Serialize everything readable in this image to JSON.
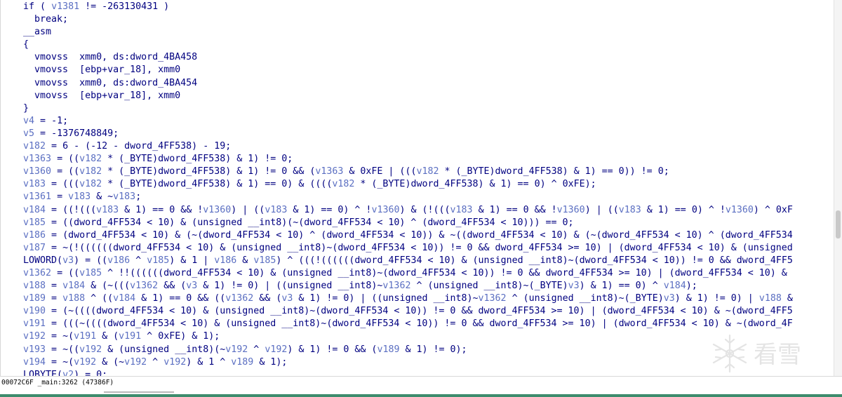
{
  "code_lines": [
    [
      {
        "t": "    if ( ",
        "c": "kw"
      },
      {
        "t": "v1381",
        "c": "var"
      },
      {
        "t": " != -263130431 )",
        "c": "txt"
      }
    ],
    [
      {
        "t": "      break;",
        "c": "txt"
      }
    ],
    [
      {
        "t": "    __asm",
        "c": "txt"
      }
    ],
    [
      {
        "t": "    {",
        "c": "txt"
      }
    ],
    [
      {
        "t": "      vmovss  xmm0, ds:dword_4BA458",
        "c": "txt"
      }
    ],
    [
      {
        "t": "      vmovss  [ebp+var_18], xmm0",
        "c": "txt"
      }
    ],
    [
      {
        "t": "      vmovss  xmm0, ds:dword_4BA454",
        "c": "txt"
      }
    ],
    [
      {
        "t": "      vmovss  [ebp+var_18], xmm0",
        "c": "txt"
      }
    ],
    [
      {
        "t": "    }",
        "c": "txt"
      }
    ],
    [
      {
        "t": "    v4",
        "c": "var"
      },
      {
        "t": " = -1;",
        "c": "txt"
      }
    ],
    [
      {
        "t": "    v5",
        "c": "var"
      },
      {
        "t": " = -1376748849;",
        "c": "txt"
      }
    ],
    [
      {
        "t": "    v182",
        "c": "var"
      },
      {
        "t": " = 6 - (-12 - dword_4FF538) - 19;",
        "c": "txt"
      }
    ],
    [
      {
        "t": "    v1363",
        "c": "var"
      },
      {
        "t": " = ((",
        "c": "txt"
      },
      {
        "t": "v182",
        "c": "var"
      },
      {
        "t": " * (_BYTE)dword_4FF538) & 1) != 0;",
        "c": "txt"
      }
    ],
    [
      {
        "t": "    v1360",
        "c": "var"
      },
      {
        "t": " = ((",
        "c": "txt"
      },
      {
        "t": "v182",
        "c": "var"
      },
      {
        "t": " * (_BYTE)dword_4FF538) & 1) != 0 && (",
        "c": "txt"
      },
      {
        "t": "v1363",
        "c": "var"
      },
      {
        "t": " & 0xFE | (((",
        "c": "txt"
      },
      {
        "t": "v182",
        "c": "var"
      },
      {
        "t": " * (_BYTE)dword_4FF538) & 1) == 0)) != 0;",
        "c": "txt"
      }
    ],
    [
      {
        "t": "    v183",
        "c": "var"
      },
      {
        "t": " = (((",
        "c": "txt"
      },
      {
        "t": "v182",
        "c": "var"
      },
      {
        "t": " * (_BYTE)dword_4FF538) & 1) == 0) & ((((",
        "c": "txt"
      },
      {
        "t": "v182",
        "c": "var"
      },
      {
        "t": " * (_BYTE)dword_4FF538) & 1) == 0) ^ 0xFE);",
        "c": "txt"
      }
    ],
    [
      {
        "t": "    v1361",
        "c": "var"
      },
      {
        "t": " = ",
        "c": "txt"
      },
      {
        "t": "v183",
        "c": "var"
      },
      {
        "t": " & ~",
        "c": "txt"
      },
      {
        "t": "v183",
        "c": "var"
      },
      {
        "t": ";",
        "c": "txt"
      }
    ],
    [
      {
        "t": "    v184",
        "c": "var"
      },
      {
        "t": " = ((!(((",
        "c": "txt"
      },
      {
        "t": "v183",
        "c": "var"
      },
      {
        "t": " & 1) == 0 && !",
        "c": "txt"
      },
      {
        "t": "v1360",
        "c": "var"
      },
      {
        "t": ") | ((",
        "c": "txt"
      },
      {
        "t": "v183",
        "c": "var"
      },
      {
        "t": " & 1) == 0) ^ !",
        "c": "txt"
      },
      {
        "t": "v1360",
        "c": "var"
      },
      {
        "t": ") & (!(((",
        "c": "txt"
      },
      {
        "t": "v183",
        "c": "var"
      },
      {
        "t": " & 1) == 0 && !",
        "c": "txt"
      },
      {
        "t": "v1360",
        "c": "var"
      },
      {
        "t": ") | ((",
        "c": "txt"
      },
      {
        "t": "v183",
        "c": "var"
      },
      {
        "t": " & 1) == 0) ^ !",
        "c": "txt"
      },
      {
        "t": "v1360",
        "c": "var"
      },
      {
        "t": ") ^ 0xF",
        "c": "txt"
      }
    ],
    [
      {
        "t": "    v185",
        "c": "var"
      },
      {
        "t": " = ((dword_4FF534 < 10) & (unsigned __int8)(~(dword_4FF534 < 10) ^ (dword_4FF534 < 10))) == 0;",
        "c": "txt"
      }
    ],
    [
      {
        "t": "    v186",
        "c": "var"
      },
      {
        "t": " = (dword_4FF534 < 10) & (~(dword_4FF534 < 10) ^ (dword_4FF534 < 10)) & ~((dword_4FF534 < 10) & (~(dword_4FF534 < 10) ^ (dword_4FF534",
        "c": "txt"
      }
    ],
    [
      {
        "t": "    v187",
        "c": "var"
      },
      {
        "t": " = ~(!((((((dword_4FF534 < 10) & (unsigned __int8)~(dword_4FF534 < 10)) != 0 && dword_4FF534 >= 10) | (dword_4FF534 < 10) & (unsigned",
        "c": "txt"
      }
    ],
    [
      {
        "t": "    LOWORD(",
        "c": "txt"
      },
      {
        "t": "v3",
        "c": "var"
      },
      {
        "t": ") = ((",
        "c": "txt"
      },
      {
        "t": "v186",
        "c": "var"
      },
      {
        "t": " ^ ",
        "c": "txt"
      },
      {
        "t": "v185",
        "c": "var"
      },
      {
        "t": ") & 1 | ",
        "c": "txt"
      },
      {
        "t": "v186",
        "c": "var"
      },
      {
        "t": " & ",
        "c": "txt"
      },
      {
        "t": "v185",
        "c": "var"
      },
      {
        "t": ") ^ (((!((((((dword_4FF534 < 10) & (unsigned __int8)~(dword_4FF534 < 10)) != 0 && dword_4FF5",
        "c": "txt"
      }
    ],
    [
      {
        "t": "    v1362",
        "c": "var"
      },
      {
        "t": " = ((",
        "c": "txt"
      },
      {
        "t": "v185",
        "c": "var"
      },
      {
        "t": " ^ !!((((((dword_4FF534 < 10) & (unsigned __int8)~(dword_4FF534 < 10)) != 0 && dword_4FF534 >= 10) | (dword_4FF534 < 10) &",
        "c": "txt"
      }
    ],
    [
      {
        "t": "    v188",
        "c": "var"
      },
      {
        "t": " = ",
        "c": "txt"
      },
      {
        "t": "v184",
        "c": "var"
      },
      {
        "t": " & (~(((",
        "c": "txt"
      },
      {
        "t": "v1362",
        "c": "var"
      },
      {
        "t": " && (",
        "c": "txt"
      },
      {
        "t": "v3",
        "c": "var"
      },
      {
        "t": " & 1) != 0) | ((unsigned __int8)~",
        "c": "txt"
      },
      {
        "t": "v1362",
        "c": "var"
      },
      {
        "t": " ^ (unsigned __int8)~(_BYTE)",
        "c": "txt"
      },
      {
        "t": "v3",
        "c": "var"
      },
      {
        "t": ") & 1) == 0) ^ ",
        "c": "txt"
      },
      {
        "t": "v184",
        "c": "var"
      },
      {
        "t": ");",
        "c": "txt"
      }
    ],
    [
      {
        "t": "    v189",
        "c": "var"
      },
      {
        "t": " = ",
        "c": "txt"
      },
      {
        "t": "v188",
        "c": "var"
      },
      {
        "t": " ^ ((",
        "c": "txt"
      },
      {
        "t": "v184",
        "c": "var"
      },
      {
        "t": " & 1) == 0 && ((",
        "c": "txt"
      },
      {
        "t": "v1362",
        "c": "var"
      },
      {
        "t": " && (",
        "c": "txt"
      },
      {
        "t": "v3",
        "c": "var"
      },
      {
        "t": " & 1) != 0) | ((unsigned __int8)~",
        "c": "txt"
      },
      {
        "t": "v1362",
        "c": "var"
      },
      {
        "t": " ^ (unsigned __int8)~(_BYTE)",
        "c": "txt"
      },
      {
        "t": "v3",
        "c": "var"
      },
      {
        "t": ") & 1) != 0) | ",
        "c": "txt"
      },
      {
        "t": "v188",
        "c": "var"
      },
      {
        "t": " &",
        "c": "txt"
      }
    ],
    [
      {
        "t": "    v190",
        "c": "var"
      },
      {
        "t": " = (~((((dword_4FF534 < 10) & (unsigned __int8)~(dword_4FF534 < 10)) != 0 && dword_4FF534 >= 10) | (dword_4FF534 < 10) & ~(dword_4FF5",
        "c": "txt"
      }
    ],
    [
      {
        "t": "    v191",
        "c": "var"
      },
      {
        "t": " = (((~((((dword_4FF534 < 10) & (unsigned __int8)~(dword_4FF534 < 10)) != 0 && dword_4FF534 >= 10) | (dword_4FF534 < 10) & ~(dword_4F",
        "c": "txt"
      }
    ],
    [
      {
        "t": "    v192",
        "c": "var"
      },
      {
        "t": " = ~(",
        "c": "txt"
      },
      {
        "t": "v191",
        "c": "var"
      },
      {
        "t": " & (",
        "c": "txt"
      },
      {
        "t": "v191",
        "c": "var"
      },
      {
        "t": " ^ 0xFE) & 1);",
        "c": "txt"
      }
    ],
    [
      {
        "t": "    v193",
        "c": "var"
      },
      {
        "t": " = ~((",
        "c": "txt"
      },
      {
        "t": "v192",
        "c": "var"
      },
      {
        "t": " & (unsigned __int8)(~",
        "c": "txt"
      },
      {
        "t": "v192",
        "c": "var"
      },
      {
        "t": " ^ ",
        "c": "txt"
      },
      {
        "t": "v192",
        "c": "var"
      },
      {
        "t": ") & 1) != 0 && (",
        "c": "txt"
      },
      {
        "t": "v189",
        "c": "var"
      },
      {
        "t": " & 1) != 0);",
        "c": "txt"
      }
    ],
    [
      {
        "t": "    v194",
        "c": "var"
      },
      {
        "t": " = ~(",
        "c": "txt"
      },
      {
        "t": "v192",
        "c": "var"
      },
      {
        "t": " & (~",
        "c": "txt"
      },
      {
        "t": "v192",
        "c": "var"
      },
      {
        "t": " ^ ",
        "c": "txt"
      },
      {
        "t": "v192",
        "c": "var"
      },
      {
        "t": ") & 1 ^ ",
        "c": "txt"
      },
      {
        "t": "v189",
        "c": "var"
      },
      {
        "t": " & 1);",
        "c": "txt"
      }
    ],
    [
      {
        "t": "    LOBYTE(",
        "c": "txt"
      },
      {
        "t": "v2",
        "c": "var"
      },
      {
        "t": ") = 0;",
        "c": "txt"
      }
    ]
  ],
  "status_bar": {
    "text": "00072C6F _main:3262 (47386F)"
  },
  "watermark": {
    "text": "看雪",
    "icon": "snowflake-logo-icon"
  },
  "colors": {
    "code_text": "#000080",
    "variable": "#5b6fc2",
    "background": "#ffffff",
    "accent_bottom": "#3d8c6d"
  }
}
